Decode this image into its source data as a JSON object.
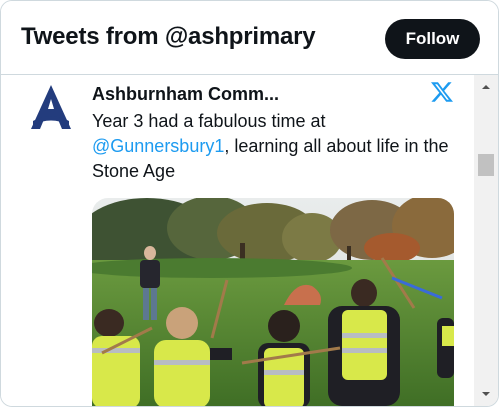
{
  "header": {
    "title": "Tweets from @ashprimary",
    "follow_label": "Follow"
  },
  "tweet": {
    "author_name": "Ashburnham Comm...",
    "avatar_letter": "A",
    "text_before": "Year 3 had a fabulous time at ",
    "mention": "@Gunnersbury1",
    "text_after": ", learning all about life in the Stone Age",
    "media_alt": "Children in hi-vis vests holding sticks in a park with autumn trees"
  },
  "icons": {
    "platform": "x-logo-icon",
    "avatar": "school-logo-icon"
  },
  "colors": {
    "follow_bg": "#0f1419",
    "mention": "#1d9bf0",
    "avatar_blue": "#233c7d"
  }
}
